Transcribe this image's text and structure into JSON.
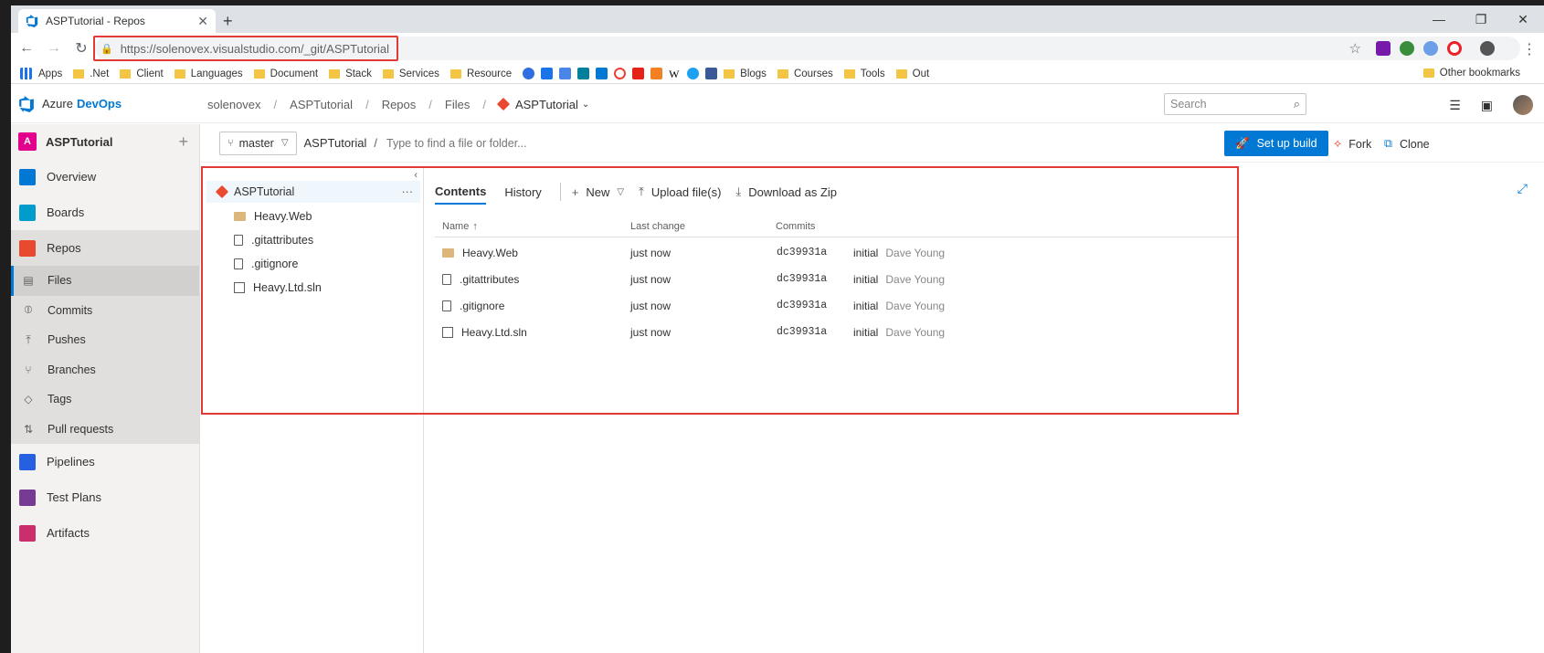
{
  "browser": {
    "tab_title": "ASPTutorial - Repos",
    "url": "https://solenovex.visualstudio.com/_git/ASPTutorial",
    "bookmarks": [
      "Apps",
      ".Net",
      "Client",
      "Languages",
      "Document",
      "Stack",
      "Services",
      "Resource"
    ],
    "bookmarks_right": [
      "Blogs",
      "Courses",
      "Tools",
      "Out"
    ],
    "other_bookmarks": "Other bookmarks"
  },
  "header": {
    "brand_prefix": "Azure",
    "brand_suffix": "DevOps",
    "breadcrumbs": [
      "solenovex",
      "ASPTutorial",
      "Repos",
      "Files"
    ],
    "repo": "ASPTutorial",
    "search_placeholder": "Search"
  },
  "sidebar": {
    "project_initial": "A",
    "project_name": "ASPTutorial",
    "items": [
      {
        "label": "Overview",
        "color": "#0078d4"
      },
      {
        "label": "Boards",
        "color": "#009ccc"
      },
      {
        "label": "Repos",
        "color": "#e8492f"
      }
    ],
    "repo_sub": [
      "Files",
      "Commits",
      "Pushes",
      "Branches",
      "Tags",
      "Pull requests"
    ],
    "items_after": [
      {
        "label": "Pipelines",
        "color": "#2560e0"
      },
      {
        "label": "Test Plans",
        "color": "#773b93"
      },
      {
        "label": "Artifacts",
        "color": "#cb2e6d"
      }
    ]
  },
  "repo_bar": {
    "branch": "master",
    "path_root": "ASPTutorial",
    "path_placeholder": "Type to find a file or folder...",
    "setup_build": "Set up build",
    "fork": "Fork",
    "clone": "Clone"
  },
  "tree": {
    "root": "ASPTutorial",
    "items": [
      {
        "name": "Heavy.Web",
        "type": "folder"
      },
      {
        "name": ".gitattributes",
        "type": "file"
      },
      {
        "name": ".gitignore",
        "type": "file"
      },
      {
        "name": "Heavy.Ltd.sln",
        "type": "sln"
      }
    ]
  },
  "content": {
    "tabs": [
      "Contents",
      "History"
    ],
    "actions": [
      "New",
      "Upload file(s)",
      "Download as Zip"
    ],
    "columns": [
      "Name",
      "Last change",
      "Commits"
    ],
    "rows": [
      {
        "name": "Heavy.Web",
        "type": "folder",
        "last_change": "just now",
        "commit": "dc39931a",
        "message": "initial",
        "author": "Dave Young"
      },
      {
        "name": ".gitattributes",
        "type": "file",
        "last_change": "just now",
        "commit": "dc39931a",
        "message": "initial",
        "author": "Dave Young"
      },
      {
        "name": ".gitignore",
        "type": "file",
        "last_change": "just now",
        "commit": "dc39931a",
        "message": "initial",
        "author": "Dave Young"
      },
      {
        "name": "Heavy.Ltd.sln",
        "type": "sln",
        "last_change": "just now",
        "commit": "dc39931a",
        "message": "initial",
        "author": "Dave Young"
      }
    ]
  }
}
